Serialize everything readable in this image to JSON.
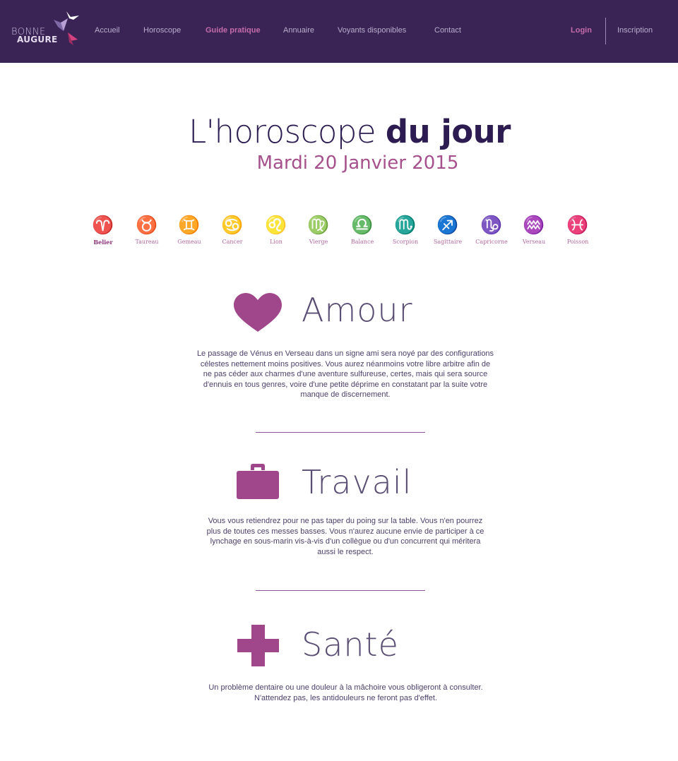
{
  "logo": {
    "line1": "BONNE",
    "line2": "AUGURE"
  },
  "nav": {
    "items": [
      {
        "label": "Accueil"
      },
      {
        "label": "Horoscope"
      },
      {
        "label": "Guide pratique"
      },
      {
        "label": "Annuaire"
      },
      {
        "label": "Voyants disponibles"
      },
      {
        "label": "Contact"
      }
    ],
    "active": "Guide pratique",
    "login": "Login",
    "signup": "Inscription"
  },
  "header": {
    "title_light": "L'horoscope",
    "title_bold": "du jour",
    "date": "Mardi 20 Janvier 2015"
  },
  "zodiac": [
    {
      "glyph": "♈",
      "name": "Belier"
    },
    {
      "glyph": "♉",
      "name": "Taureau"
    },
    {
      "glyph": "♊",
      "name": "Gemeau"
    },
    {
      "glyph": "♋",
      "name": "Cancer"
    },
    {
      "glyph": "♌",
      "name": "Lion"
    },
    {
      "glyph": "♍",
      "name": "Vierge"
    },
    {
      "glyph": "♎",
      "name": "Balance"
    },
    {
      "glyph": "♏",
      "name": "Scorpion"
    },
    {
      "glyph": "♐",
      "name": "Sagittaire"
    },
    {
      "glyph": "♑",
      "name": "Capricorne"
    },
    {
      "glyph": "♒",
      "name": "Verseau"
    },
    {
      "glyph": "♓",
      "name": "Poisson"
    }
  ],
  "sections": {
    "amour": {
      "title": "Amour",
      "icon": "heart-icon",
      "text": "Le passage de Vénus en Verseau dans un signe ami sera noyé par des configurations célestes nettement moins positives. Vous aurez néanmoins votre libre arbitre afin de ne pas céder aux charmes d'une aventure sulfureuse, certes, mais qui sera source d'ennuis en tous genres, voire d'une petite déprime en constatant par la suite votre manque de discernement."
    },
    "travail": {
      "title": "Travail",
      "icon": "briefcase-icon",
      "text": "Vous vous retiendrez pour ne pas taper du poing sur la table. Vous n'en pourrez plus de toutes ces messes basses. Vous n'aurez aucune envie de participer à ce lynchage en sous-marin vis-à-vis d'un collègue ou d'un concurrent qui méritera aussi le respect."
    },
    "sante": {
      "title": "Santé",
      "icon": "medical-cross-icon",
      "text": "Un problème dentaire ou une douleur à la mâchoire vous obligeront à consulter. N'attendez pas, les antidouleurs ne feront pas d'effet."
    }
  },
  "colors": {
    "header_bg": "#3a2456",
    "accent": "#a6508c",
    "title_dark": "#2c1c52",
    "icon": "#a0468a"
  }
}
